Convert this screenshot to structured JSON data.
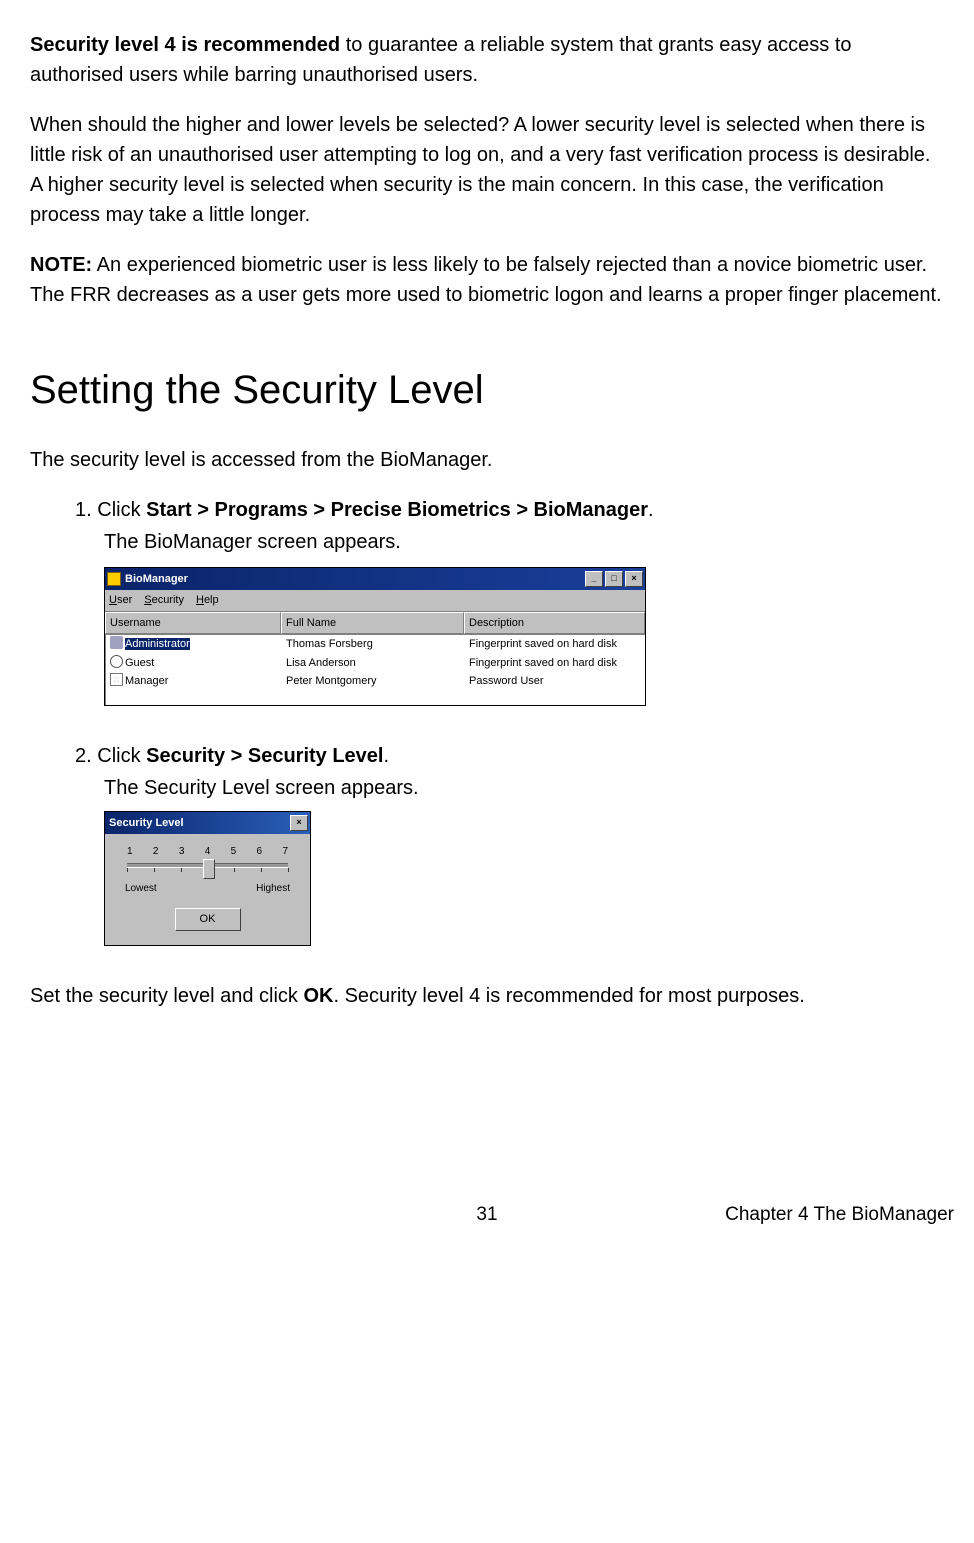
{
  "intro": {
    "strong_lead": "Security level 4 is recommended",
    "lead_rest": " to guarantee a reliable system that grants easy access to authorised users while barring unauthorised users.",
    "para2": "When should the higher and lower levels be selected? A lower security level is selected when there is little risk of an unauthorised user attempting to log on, and a very fast verification process is desirable. A higher security level is selected when security is the main concern. In this case, the verification process may take a little longer.",
    "note_label": "NOTE:",
    "note_rest": " An experienced biometric user is less likely to be falsely rejected than a novice biometric user. The FRR decreases as a user gets more used to biometric logon and learns a proper finger placement."
  },
  "heading": "Setting the Security Level",
  "subheading": "The security level is accessed from the BioManager.",
  "step1": {
    "num": "1. ",
    "pre": "Click ",
    "bold": "Start > Programs > Precise Biometrics > BioManager",
    "post": ".",
    "sub": "The BioManager screen appears."
  },
  "biomgr": {
    "title": "BioManager",
    "menu_user": "User",
    "menu_security": "Security",
    "menu_help": "Help",
    "col_user": "Username",
    "col_full": "Full Name",
    "col_desc": "Description",
    "rows": [
      {
        "user": "Administrator",
        "full": "Thomas Forsberg",
        "desc": "Fingerprint saved on hard disk"
      },
      {
        "user": "Guest",
        "full": "Lisa Anderson",
        "desc": "Fingerprint saved on hard disk"
      },
      {
        "user": "Manager",
        "full": "Peter Montgomery",
        "desc": "Password User"
      }
    ]
  },
  "step2": {
    "num": "2. ",
    "pre": "Click ",
    "bold": "Security > Security Level",
    "post": ".",
    "sub": "The Security Level screen appears."
  },
  "secwin": {
    "title": "Security Level",
    "nums": [
      "1",
      "2",
      "3",
      "4",
      "5",
      "6",
      "7"
    ],
    "lowest": "Lowest",
    "highest": "Highest",
    "ok": "OK"
  },
  "closing": {
    "pre": "Set the security level and click ",
    "bold": "OK",
    "post": ". Security level 4 is recommended for most purposes."
  },
  "footer": {
    "page": "31",
    "chapter": "Chapter 4 The BioManager"
  }
}
